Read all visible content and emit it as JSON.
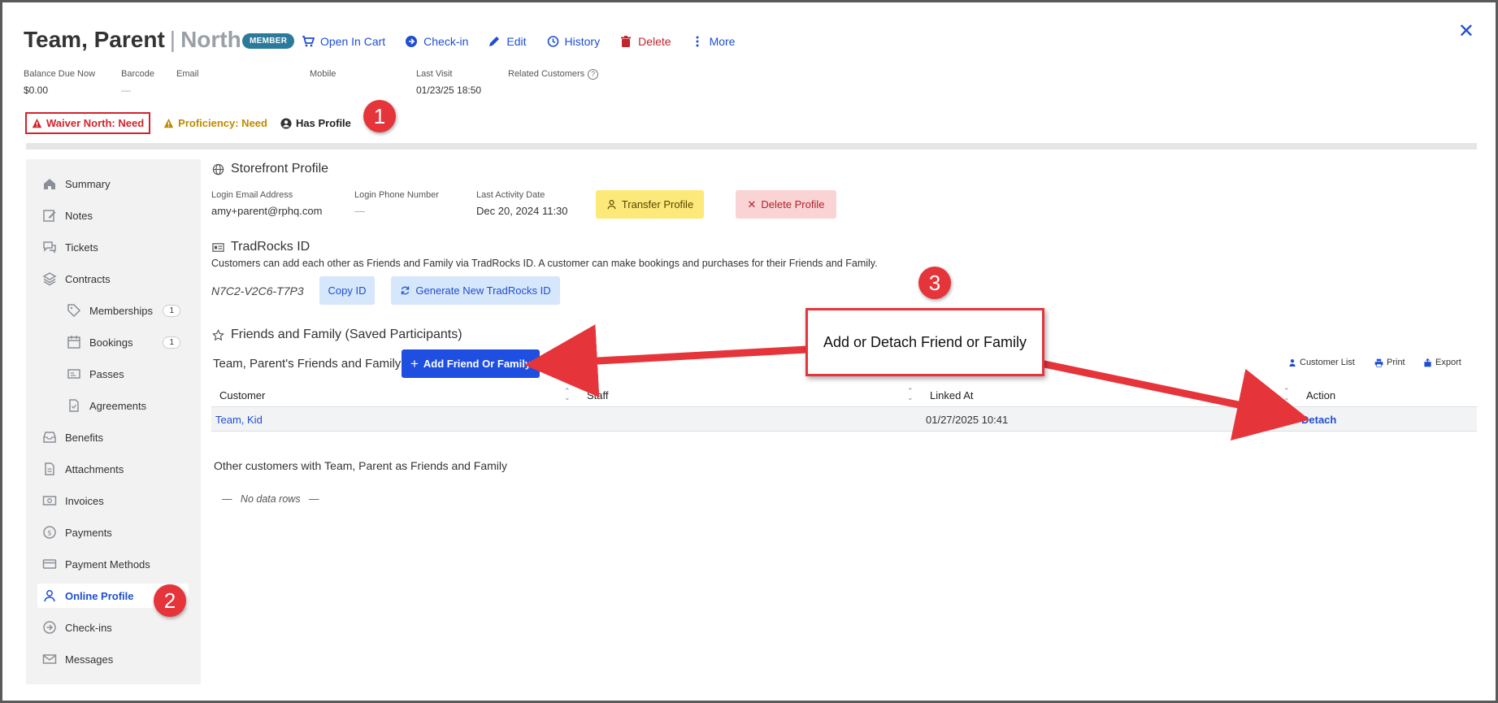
{
  "header": {
    "name": "Team, Parent",
    "separator": "|",
    "location": "North",
    "member_badge": "MEMBER",
    "actions": {
      "open_in_cart": "Open In Cart",
      "check_in": "Check-in",
      "edit": "Edit",
      "history": "History",
      "delete": "Delete",
      "more": "More"
    },
    "close": "✕"
  },
  "meta": {
    "balance_label": "Balance Due Now",
    "balance_value": "$0.00",
    "barcode_label": "Barcode",
    "barcode_value": "—",
    "email_label": "Email",
    "mobile_label": "Mobile",
    "last_visit_label": "Last Visit",
    "last_visit_value": "01/23/25 18:50",
    "related_label": "Related Customers"
  },
  "status": {
    "waiver": "Waiver North: Need",
    "proficiency": "Proficiency: Need",
    "has_profile": "Has Profile"
  },
  "callouts": {
    "one": "1",
    "two": "2",
    "three": "3"
  },
  "sidebar": {
    "items": [
      {
        "label": "Summary"
      },
      {
        "label": "Notes"
      },
      {
        "label": "Tickets"
      },
      {
        "label": "Contracts"
      },
      {
        "label": "Memberships",
        "count": "1"
      },
      {
        "label": "Bookings",
        "count": "1"
      },
      {
        "label": "Passes"
      },
      {
        "label": "Agreements"
      },
      {
        "label": "Benefits"
      },
      {
        "label": "Attachments"
      },
      {
        "label": "Invoices"
      },
      {
        "label": "Payments"
      },
      {
        "label": "Payment Methods"
      },
      {
        "label": "Online Profile"
      },
      {
        "label": "Check-ins"
      },
      {
        "label": "Messages"
      }
    ]
  },
  "storefront": {
    "title": "Storefront Profile",
    "login_email_label": "Login Email Address",
    "login_email_value": "amy+parent@rphq.com",
    "login_phone_label": "Login Phone Number",
    "login_phone_value": "—",
    "last_activity_label": "Last Activity Date",
    "last_activity_value": "Dec 20, 2024 11:30",
    "transfer_button": "Transfer Profile",
    "delete_button": "Delete Profile"
  },
  "tradrocks": {
    "title": "TradRocks ID",
    "description": "Customers can add each other as Friends and Family via TradRocks ID. A customer can make bookings and purchases for their Friends and Family.",
    "id_value": "N7C2-V2C6-T7P3",
    "copy_button": "Copy ID",
    "generate_button": "Generate New TradRocks ID"
  },
  "friends": {
    "title": "Friends and Family (Saved Participants)",
    "owner_name": "Team, Parent's",
    "owner_suffix": "Friends and Family",
    "add_button": "Add Friend Or Family",
    "customer_list": "Customer List",
    "print": "Print",
    "export": "Export",
    "columns": [
      "Customer",
      "Staff",
      "Linked At",
      "Action"
    ],
    "rows": [
      {
        "customer": "Team, Kid",
        "staff": "",
        "linked_at": "01/27/2025 10:41",
        "action": "Detach"
      }
    ],
    "other_prefix": "Other customers with",
    "other_name": "Team, Parent",
    "other_suffix": "as Friends and Family",
    "no_data": "No data rows"
  },
  "annotation": {
    "text": "Add or Detach Friend or Family"
  }
}
